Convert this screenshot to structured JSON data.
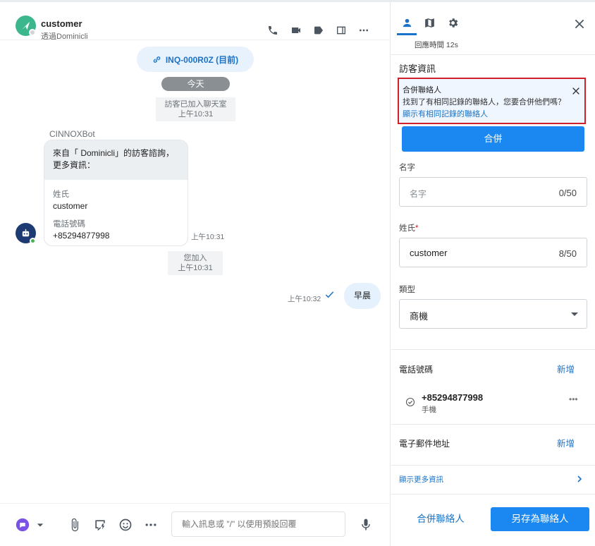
{
  "chat": {
    "contact_name": "customer",
    "contact_sub": "透過Dominicli",
    "header_icons": [
      "phone-icon",
      "video-icon",
      "tag-icon",
      "panel-toggle-icon",
      "more-icon"
    ],
    "inquiry_label": "INQ-000R0Z (目前)",
    "date_divider": "今天",
    "system1_line1": "訪客已加入聊天室",
    "system1_line2": "上午10:31",
    "bot_name": "CINNOXBot",
    "bot_intro_line1": "來自「 Dominicli」的訪客諮詢，",
    "bot_intro_line2": "更多資訊：",
    "field1_label": "姓氏",
    "field1_value": "customer",
    "field2_label": "電話號碼",
    "field2_value": "+85294877998",
    "bot_time": "上午10:31",
    "system2_line1": "您加入",
    "system2_line2": "上午10:31",
    "out_time": "上午10:32",
    "out_text": "早晨",
    "composer_placeholder": "輸入訊息或 \"/\" 以使用預設回覆"
  },
  "panel": {
    "tabs": [
      "person-icon",
      "map-icon",
      "gear-icon"
    ],
    "response_time": "回應時間 12s",
    "section_title": "訪客資訊",
    "alert_title": "合併聯絡人",
    "alert_text": "找到了有相同記錄的聯絡人，您要合併他們嗎？",
    "alert_link": "顯示有相同記錄的聯絡人",
    "merge_button": "合併",
    "first_name_label": "名字",
    "first_name_placeholder": "名字",
    "first_name_count": "0/50",
    "last_name_label": "姓氏",
    "last_name_required": "*",
    "last_name_value": "customer",
    "last_name_count": "8/50",
    "type_label": "類型",
    "type_value": "商機",
    "phone_section": "電話號碼",
    "phone_add": "新增",
    "phone_number": "+85294877998",
    "phone_type": "手機",
    "email_section": "電子郵件地址",
    "email_add": "新增",
    "show_more": "顯示更多資訊",
    "footer_merge": "合併聯絡人",
    "footer_save": "另存為聯絡人"
  },
  "colors": {
    "accent": "#1a88f0",
    "link": "#1a73c8",
    "alert_border": "#d0202a",
    "customer_avatar": "#3cb68c",
    "bot_avatar": "#1d3a73"
  }
}
